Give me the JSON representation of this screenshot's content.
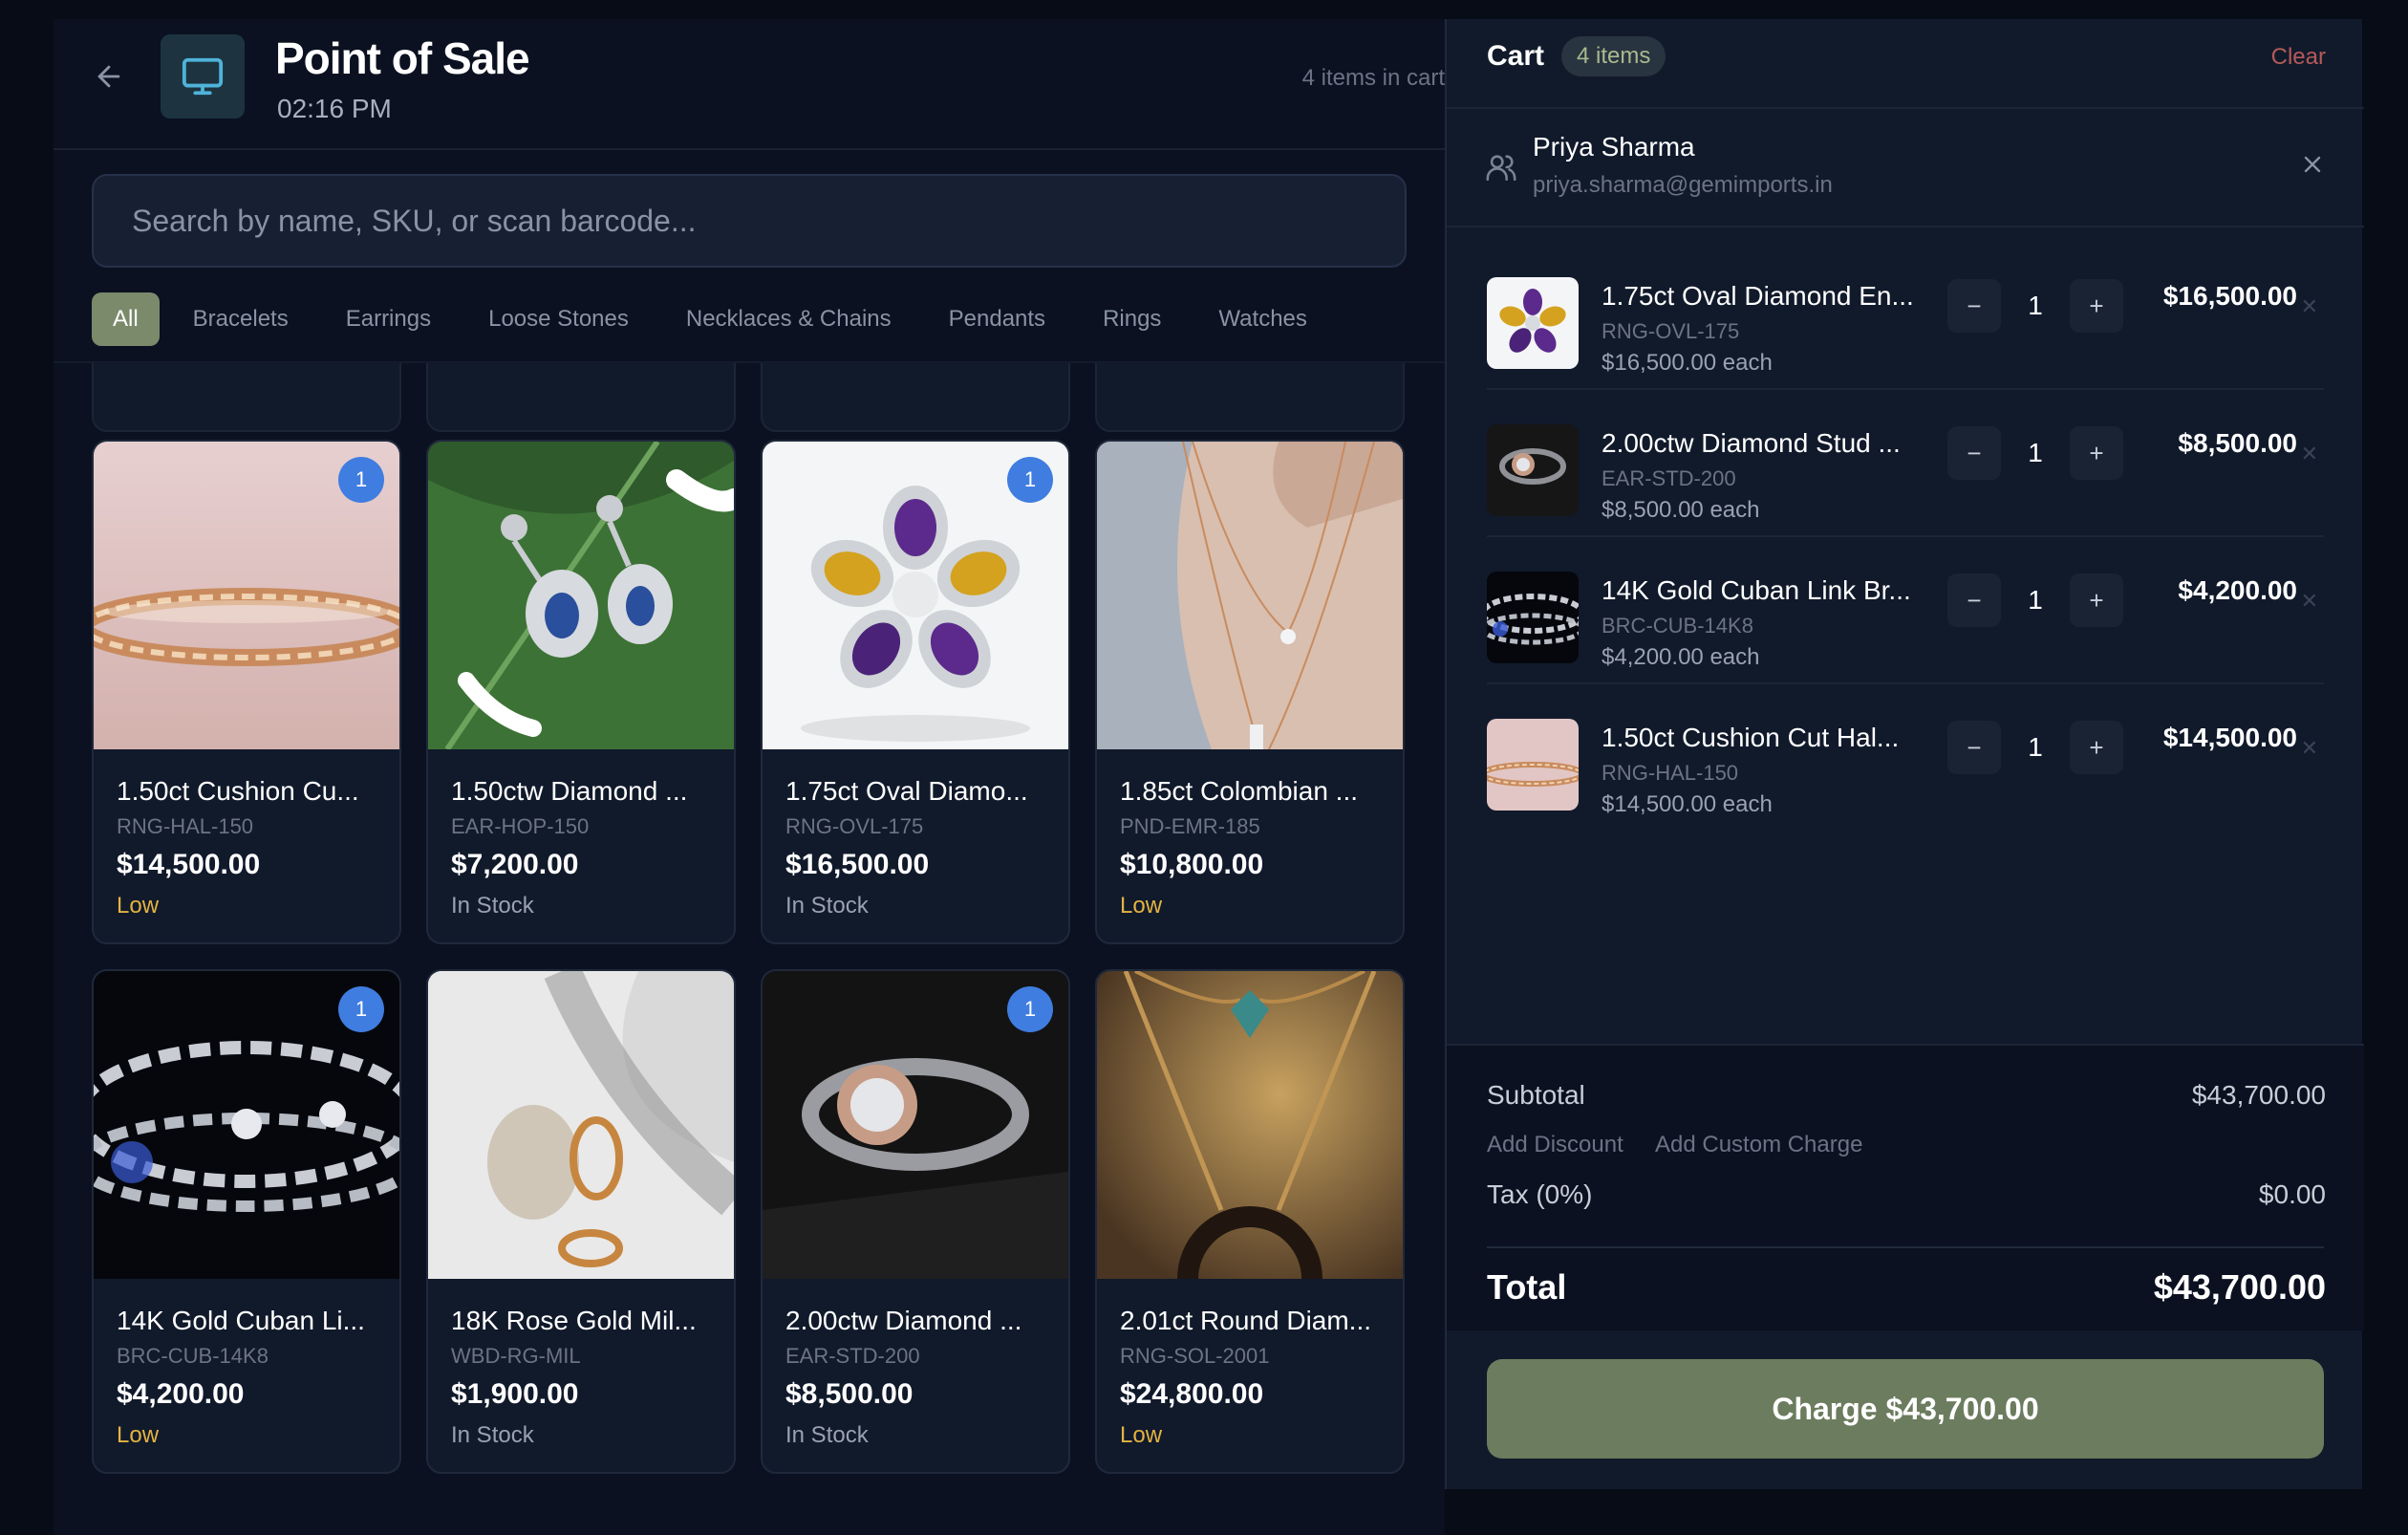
{
  "header": {
    "title": "Point of Sale",
    "time": "02:16 PM",
    "items_in_cart": "4 items in cart"
  },
  "search": {
    "placeholder": "Search by name, SKU, or scan barcode..."
  },
  "categories": [
    "All",
    "Bracelets",
    "Earrings",
    "Loose Stones",
    "Necklaces & Chains",
    "Pendants",
    "Rings",
    "Watches"
  ],
  "active_category": "All",
  "products": [
    {
      "name": "1.50ct Cushion Cu...",
      "sku": "RNG-HAL-150",
      "price": "$14,500.00",
      "stock": "Low",
      "badge": "1"
    },
    {
      "name": "1.50ctw Diamond ...",
      "sku": "EAR-HOP-150",
      "price": "$7,200.00",
      "stock": "In Stock",
      "badge": ""
    },
    {
      "name": "1.75ct Oval Diamo...",
      "sku": "RNG-OVL-175",
      "price": "$16,500.00",
      "stock": "In Stock",
      "badge": "1"
    },
    {
      "name": "1.85ct Colombian ...",
      "sku": "PND-EMR-185",
      "price": "$10,800.00",
      "stock": "Low",
      "badge": ""
    },
    {
      "name": "14K Gold Cuban Li...",
      "sku": "BRC-CUB-14K8",
      "price": "$4,200.00",
      "stock": "Low",
      "badge": "1"
    },
    {
      "name": "18K Rose Gold Mil...",
      "sku": "WBD-RG-MIL",
      "price": "$1,900.00",
      "stock": "In Stock",
      "badge": ""
    },
    {
      "name": "2.00ctw Diamond ...",
      "sku": "EAR-STD-200",
      "price": "$8,500.00",
      "stock": "In Stock",
      "badge": "1"
    },
    {
      "name": "2.01ct Round Diam...",
      "sku": "RNG-SOL-2001",
      "price": "$24,800.00",
      "stock": "Low",
      "badge": ""
    }
  ],
  "cart": {
    "title": "Cart",
    "count": "4 items",
    "clear": "Clear",
    "customer": {
      "name": "Priya Sharma",
      "email": "priya.sharma@gemimports.in"
    },
    "lines": [
      {
        "name": "1.75ct Oval Diamond En...",
        "sku": "RNG-OVL-175",
        "each": "$16,500.00 each",
        "qty": "1",
        "total": "$16,500.00"
      },
      {
        "name": "2.00ctw Diamond Stud ...",
        "sku": "EAR-STD-200",
        "each": "$8,500.00 each",
        "qty": "1",
        "total": "$8,500.00"
      },
      {
        "name": "14K Gold Cuban Link Br...",
        "sku": "BRC-CUB-14K8",
        "each": "$4,200.00 each",
        "qty": "1",
        "total": "$4,200.00"
      },
      {
        "name": "1.50ct Cushion Cut Hal...",
        "sku": "RNG-HAL-150",
        "each": "$14,500.00 each",
        "qty": "1",
        "total": "$14,500.00"
      }
    ],
    "summary": {
      "subtotal_label": "Subtotal",
      "subtotal": "$43,700.00",
      "add_discount": "Add Discount",
      "add_custom_charge": "Add Custom Charge",
      "tax_label": "Tax (0%)",
      "tax": "$0.00",
      "total_label": "Total",
      "total": "$43,700.00"
    },
    "charge_button": "Charge $43,700.00"
  },
  "colors": {
    "accent_green": "#7a8a6b",
    "badge_blue": "#3f7de0",
    "low_stock": "#e3b341",
    "clear_red": "#b45a5a"
  }
}
